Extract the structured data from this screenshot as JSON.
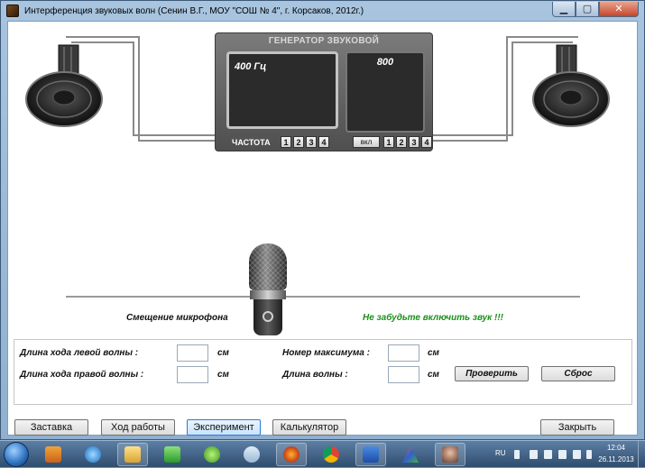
{
  "window": {
    "title": "Интерференция звуковых волн  (Сенин В.Г., МОУ \"СОШ № 4\", г. Корсаков, 2012г.)",
    "controls": {
      "minimize": "▁",
      "maximize": "▢",
      "close": "✕"
    }
  },
  "generator": {
    "title": "ГЕНЕРАТОР ЗВУКОВОЙ",
    "frequency_display": "400 Гц",
    "value_display": "800",
    "frequency_label": "ЧАСТОТА",
    "frequency_buttons": [
      "1",
      "2",
      "3",
      "4"
    ],
    "power_label": "вкл",
    "power_buttons": [
      "1",
      "2",
      "3",
      "4"
    ]
  },
  "stage": {
    "mic_label": "Смещение микрофона",
    "reminder": "Не забудьте включить звук !!!"
  },
  "measurements": {
    "left_path_label": "Длина хода левой волны :",
    "right_path_label": "Длина хода правой волны :",
    "max_number_label": "Номер максимума :",
    "wavelength_label": "Длина волны :",
    "unit": "см",
    "left_path_value": "",
    "right_path_value": "",
    "max_number_value": "",
    "wavelength_value": "",
    "check_button": "Проверить",
    "reset_button": "Сброс"
  },
  "bottom_buttons": {
    "intro": "Заставка",
    "procedure": "Ход работы",
    "experiment": "Эксперимент",
    "calculator": "Калькулятор",
    "close": "Закрыть"
  },
  "taskbar": {
    "language": "RU",
    "time": "12:04",
    "date": "26.11.2013",
    "icons": [
      "start-orb-icon",
      "media-player-icon",
      "internet-explorer-icon",
      "file-explorer-icon",
      "chart-app-icon",
      "icq-icon",
      "wifi-app-icon",
      "firefox-icon",
      "chrome-icon",
      "word-icon",
      "triangle-app-icon",
      "photo-thumbnail-icon"
    ]
  },
  "colors": {
    "reminder_text": "#199019",
    "generator_body": "#5a5a5a",
    "screen": "#2b2b2b"
  }
}
